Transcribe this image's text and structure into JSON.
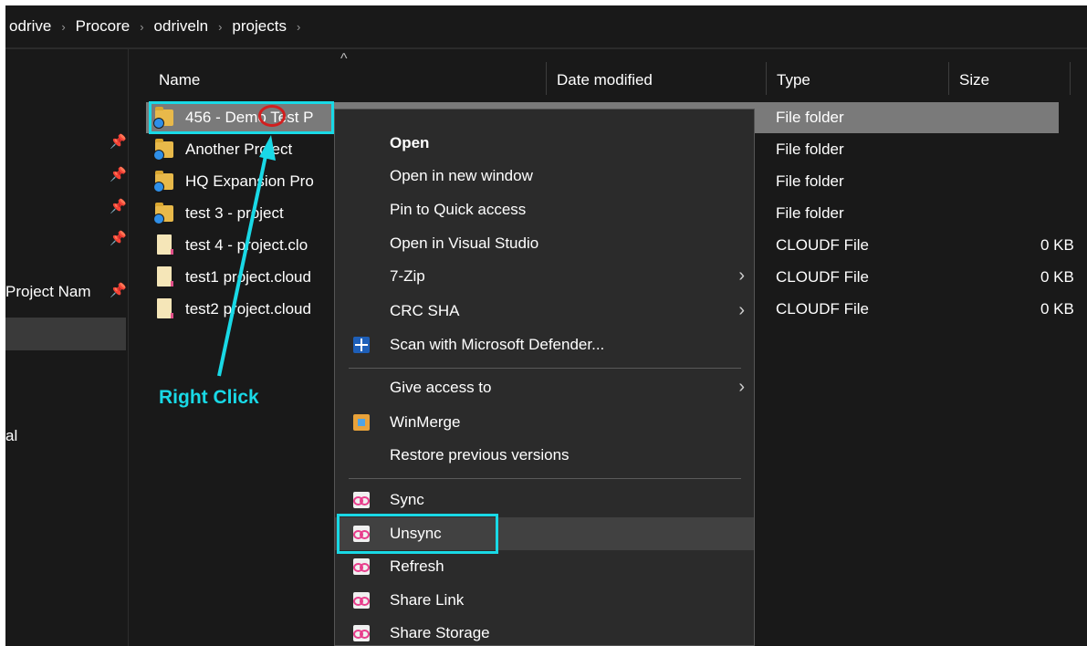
{
  "breadcrumb": {
    "items": [
      "odrive",
      "Procore",
      "odriveln",
      "projects"
    ],
    "separator": "›"
  },
  "nav": {
    "project_label": "Project Nam",
    "local_label": "al"
  },
  "columns": {
    "name": "Name",
    "date_modified": "Date modified",
    "type": "Type",
    "size": "Size"
  },
  "files": [
    {
      "name": "456 - Demo Test P",
      "type": "File folder",
      "size": "",
      "icon": "folder-sync-icon"
    },
    {
      "name": "Another Project",
      "type": "File folder",
      "size": "",
      "icon": "folder-sync-icon"
    },
    {
      "name": "HQ Expansion Pro",
      "type": "File folder",
      "size": "",
      "icon": "folder-sync-icon"
    },
    {
      "name": "test 3 - project",
      "type": "File folder",
      "size": "",
      "icon": "folder-sync-icon"
    },
    {
      "name": "test 4 - project.clo",
      "type": "CLOUDF File",
      "size": "0 KB",
      "icon": "cloudf-file-icon"
    },
    {
      "name": "test1 project.cloud",
      "type": "CLOUDF File",
      "size": "0 KB",
      "icon": "cloudf-file-icon"
    },
    {
      "name": "test2 project.cloud",
      "type": "CLOUDF File",
      "size": "0 KB",
      "icon": "cloudf-file-icon"
    }
  ],
  "context_menu": {
    "open": "Open",
    "open_new_window": "Open in new window",
    "pin_quick_access": "Pin to Quick access",
    "open_visual_studio": "Open in Visual Studio",
    "seven_zip": "7-Zip",
    "crc_sha": "CRC SHA",
    "scan_defender": "Scan with Microsoft Defender...",
    "give_access": "Give access to",
    "winmerge": "WinMerge",
    "restore_versions": "Restore previous versions",
    "sync": "Sync",
    "unsync": "Unsync",
    "refresh": "Refresh",
    "share_link": "Share Link",
    "share_storage": "Share Storage"
  },
  "annotation": {
    "label": "Right Click"
  },
  "colors": {
    "highlight": "#19d9e6",
    "marker": "#d21f1f",
    "background": "#191919",
    "menu_bg": "#2b2b2b"
  }
}
